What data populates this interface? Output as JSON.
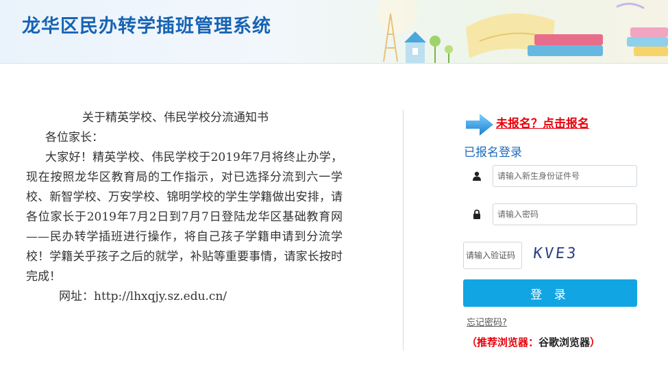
{
  "header": {
    "title": "龙华区民办转学插班管理系统"
  },
  "notice": {
    "title": "关于精英学校、伟民学校分流通知书",
    "greeting": "各位家长：",
    "body": "大家好！精英学校、伟民学校于2019年7月将终止办学，现在按照龙华区教育局的工作指示，对已选择分流到六一学校、新智学校、万安学校、锦明学校的学生学籍做出安排，请各位家长于2019年7月2日到7月7日登陆龙华区基础教育网——民办转学插班进行操作，将自己孩子学籍申请到分流学校！学籍关乎孩子之后的就学，补贴等重要事情，请家长按时完成！",
    "url": "网址：http://lhxqjy.sz.edu.cn/"
  },
  "login": {
    "register_link": "未报名？点击报名",
    "registered_title": "已报名登录",
    "id_placeholder": "请输入新生身份证件号",
    "password_placeholder": "请输入密码",
    "captcha_placeholder": "请输入验证码",
    "captcha_text": "KVE3",
    "submit_label": "登 录",
    "forgot_label": "忘记密码?",
    "browser_tip_open": "（推荐浏览器：",
    "browser_tip_name": "谷歌浏览器",
    "browser_tip_close": "）"
  },
  "colors": {
    "brand_blue": "#1763b3",
    "button_blue": "#12a5e4",
    "alert_red": "#e8000b"
  },
  "icons": [
    "user-icon",
    "lock-icon",
    "right-arrow-icon"
  ]
}
